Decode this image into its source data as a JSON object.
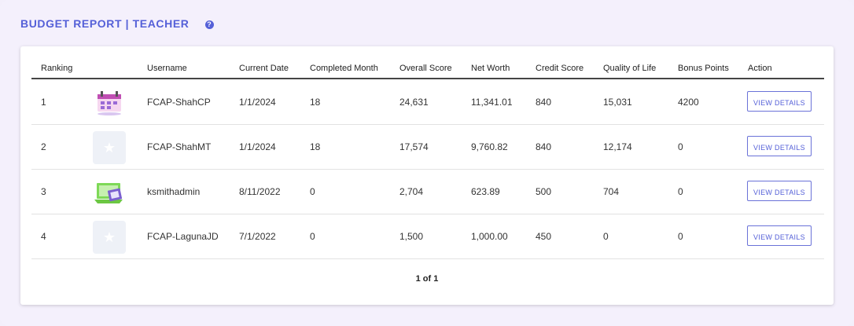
{
  "header": {
    "title": "BUDGET REPORT | TEACHER",
    "help_icon": "?"
  },
  "table": {
    "columns": {
      "ranking": "Ranking",
      "username": "Username",
      "current_date": "Current Date",
      "completed_month": "Completed Month",
      "overall_score": "Overall Score",
      "net_worth": "Net Worth",
      "credit_score": "Credit Score",
      "quality_of_life": "Quality of Life",
      "bonus_points": "Bonus Points",
      "action": "Action"
    },
    "rows": [
      {
        "ranking": "1",
        "avatar": "calendar-avatar-icon",
        "username": "FCAP-ShahCP",
        "current_date": "1/1/2024",
        "completed_month": "18",
        "overall_score": "24,631",
        "net_worth": "11,341.01",
        "credit_score": "840",
        "quality_of_life": "15,031",
        "bonus_points": "4200",
        "action": "VIEW DETAILS"
      },
      {
        "ranking": "2",
        "avatar": "star-placeholder-icon",
        "username": "FCAP-ShahMT",
        "current_date": "1/1/2024",
        "completed_month": "18",
        "overall_score": "17,574",
        "net_worth": "9,760.82",
        "credit_score": "840",
        "quality_of_life": "12,174",
        "bonus_points": "0",
        "action": "VIEW DETAILS"
      },
      {
        "ranking": "3",
        "avatar": "laptop-avatar-icon",
        "username": "ksmithadmin",
        "current_date": "8/11/2022",
        "completed_month": "0",
        "overall_score": "2,704",
        "net_worth": "623.89",
        "credit_score": "500",
        "quality_of_life": "704",
        "bonus_points": "0",
        "action": "VIEW DETAILS"
      },
      {
        "ranking": "4",
        "avatar": "star-placeholder-icon",
        "username": "FCAP-LagunaJD",
        "current_date": "7/1/2022",
        "completed_month": "0",
        "overall_score": "1,500",
        "net_worth": "1,000.00",
        "credit_score": "450",
        "quality_of_life": "0",
        "bonus_points": "0",
        "action": "VIEW DETAILS"
      }
    ]
  },
  "pagination": {
    "label": "1 of 1"
  },
  "colors": {
    "accent": "#5560d8",
    "background": "#f4f0fc",
    "card": "#ffffff"
  }
}
